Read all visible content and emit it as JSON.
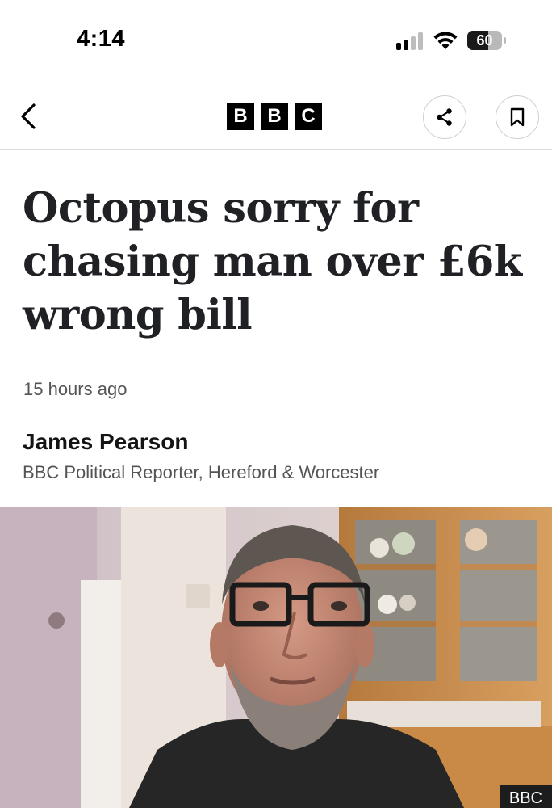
{
  "status_bar": {
    "time": "4:14",
    "battery_level": "60",
    "battery_fraction": 0.6,
    "signal_bars_active": 2,
    "signal_bars_total": 4
  },
  "nav": {
    "logo_letters": [
      "B",
      "B",
      "C"
    ],
    "back_icon": "chevron-left-icon",
    "share_icon": "share-icon",
    "bookmark_icon": "bookmark-icon"
  },
  "article": {
    "headline_lines": [
      "Octopus sorry for",
      "chasing man over £6k",
      "wrong bill"
    ],
    "timestamp": "15 hours ago",
    "author_name": "James Pearson",
    "author_role": "BBC Political Reporter, Hereford & Worcester"
  },
  "photo": {
    "credit": "BBC"
  },
  "colors": {
    "text": "#202124",
    "secondary_text": "#545454",
    "logo_bg": "#000000",
    "divider": "#dcdcdc"
  }
}
